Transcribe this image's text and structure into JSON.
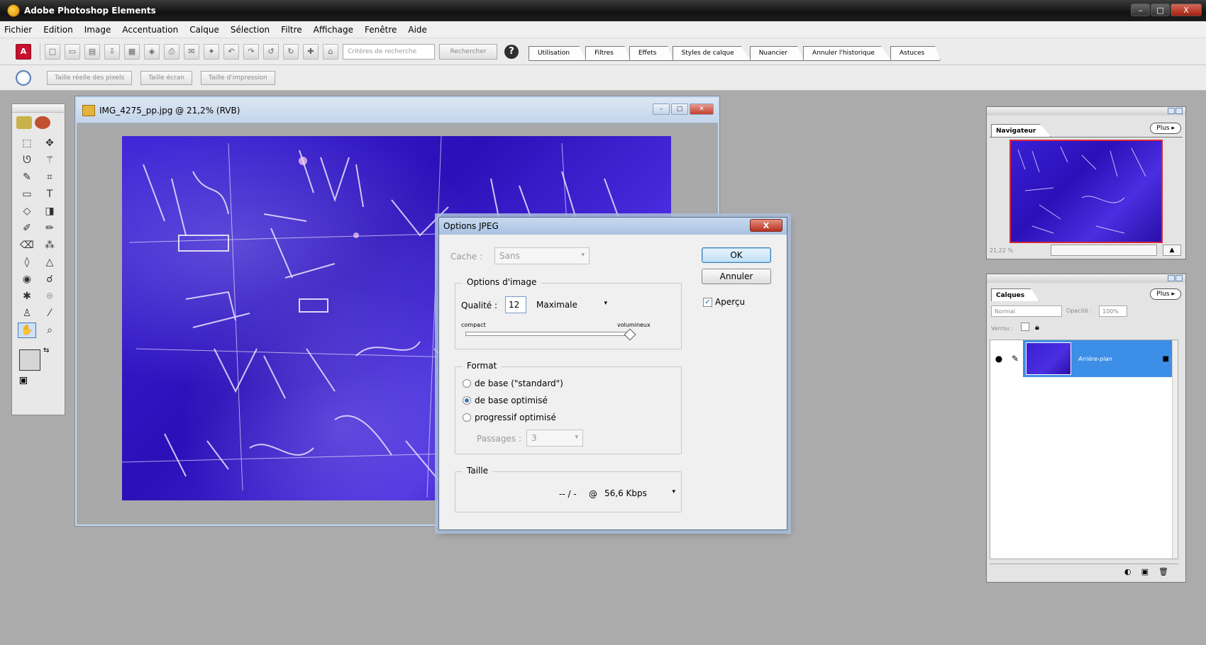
{
  "app": {
    "title": "Adobe Photoshop Elements",
    "window_buttons": [
      "–",
      "□",
      "X"
    ]
  },
  "menu": [
    "Fichier",
    "Edition",
    "Image",
    "Accentuation",
    "Calque",
    "Sélection",
    "Filtre",
    "Affichage",
    "Fenêtre",
    "Aide"
  ],
  "toolbar": {
    "search_placeholder": "Critères de recherche",
    "search_button": "Rechercher",
    "help_glyph": "?",
    "palette_tabs": [
      "Utilisation",
      "Filtres",
      "Effets",
      "Styles de calque",
      "Nuancier",
      "Annuler l'historique",
      "Astuces"
    ]
  },
  "options_bar": {
    "buttons": [
      "Taille réelle des pixels",
      "Taille écran",
      "Taille d'impression"
    ]
  },
  "document": {
    "title": "IMG_4275_pp.jpg @ 21,2% (RVB)"
  },
  "jpeg_dialog": {
    "title": "Options JPEG",
    "close_label": "X",
    "matte_label": "Cache :",
    "matte_value": "Sans",
    "image_options_legend": "Options d'image",
    "quality_label": "Qualité :",
    "quality_value": "12",
    "quality_preset": "Maximale",
    "quality_level": 1.0,
    "slider_min_label": "compact",
    "slider_max_label": "volumineux",
    "format_legend": "Format",
    "format_options": [
      {
        "label": "de base (\"standard\")",
        "selected": false
      },
      {
        "label": "de base optimisé",
        "selected": true
      },
      {
        "label": "progressif optimisé",
        "selected": false
      }
    ],
    "scans_label": "Passages :",
    "scans_value": "3",
    "size_legend": "Taille",
    "size_value": "-- / -",
    "size_at": "@",
    "size_speed": "56,6 Kbps",
    "ok_label": "OK",
    "cancel_label": "Annuler",
    "preview_label": "Aperçu",
    "preview_checked": true
  },
  "navigator": {
    "tab": "Navigateur",
    "more": "Plus",
    "zoom": "21,22 %"
  },
  "layers": {
    "tab": "Calques",
    "more": "Plus",
    "blend_mode": "Normal",
    "opacity_label": "Opacité :",
    "opacity_value": "100%",
    "lock_label": "Verrou :",
    "layer_name": "Arrière-plan"
  },
  "colors": {
    "photo_primary": "#3a1fd6",
    "selection_blue": "#3d8ee6",
    "navigator_frame": "#d7263a"
  }
}
